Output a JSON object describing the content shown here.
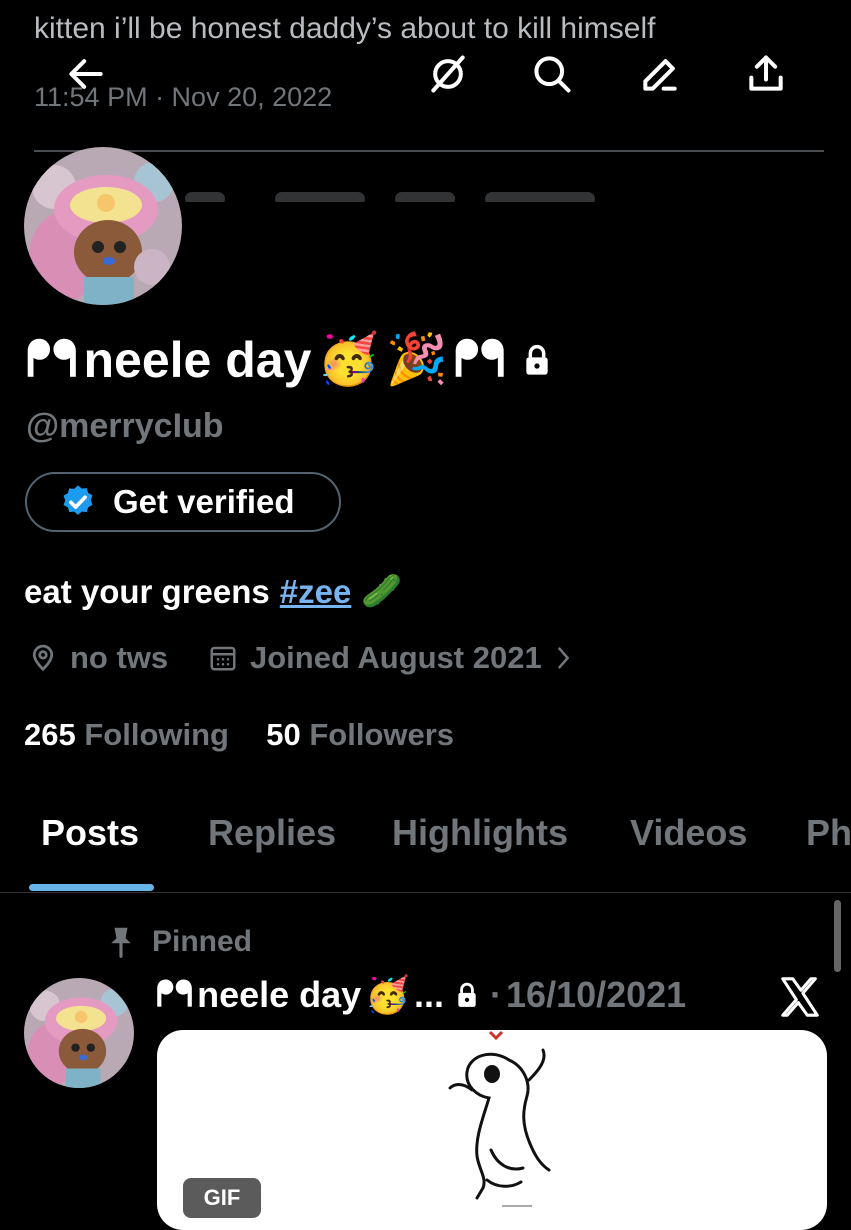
{
  "overlay": {
    "tweet_text": "kitten i’ll be honest daddy’s about to kill himself",
    "tweet_time": "11:54 PM · Nov 20, 2022"
  },
  "topbar": {
    "icons": [
      "back-arrow-icon",
      "grok-icon",
      "search-icon",
      "edit-icon",
      "share-icon"
    ]
  },
  "profile": {
    "name_lead": "ᖰᖳ",
    "name": "neele day",
    "name_emojis": [
      "🥳",
      "🎉"
    ],
    "name_trail": "ᖰᖳ",
    "handle": "@merrycIub",
    "verify_label": "Get verified",
    "bio_text": "eat your greens",
    "bio_hashtag": "#zee",
    "bio_emoji": "🥒",
    "location": "no tws",
    "joined": "Joined August 2021",
    "following_count": "265",
    "following_label": "Following",
    "followers_count": "50",
    "followers_label": "Followers"
  },
  "tabs": [
    {
      "label": "Posts",
      "active": true
    },
    {
      "label": "Replies",
      "active": false
    },
    {
      "label": "Highlights",
      "active": false
    },
    {
      "label": "Videos",
      "active": false
    },
    {
      "label": "Ph",
      "active": false
    }
  ],
  "pinned_post": {
    "pinned_label": "Pinned",
    "name_lead": "ᖰᖳ",
    "name": "neele day",
    "emoji": "🥳",
    "ellipsis": "...",
    "separator": "·",
    "date": "16/10/2021",
    "gif_label": "GIF"
  },
  "colors": {
    "background": "#000000",
    "text": "#e7e9ea",
    "muted": "#71767b",
    "accent": "#1d9bf0",
    "link": "#78b4f0"
  }
}
